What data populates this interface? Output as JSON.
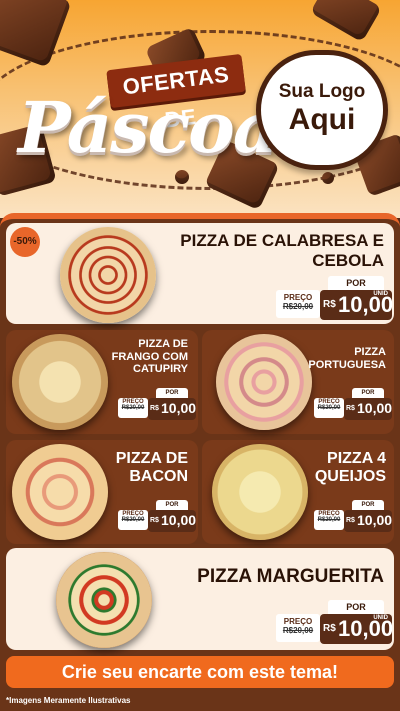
{
  "header": {
    "title_top": "OFERTAS DE",
    "title_main": "Páscoa",
    "logo_line1": "Sua Logo",
    "logo_line2": "Aqui"
  },
  "discount_badge": "-50%",
  "price_labels": {
    "preco": "PREÇO",
    "por": "POR",
    "unid": "UNID",
    "currency": "R$"
  },
  "products": [
    {
      "name_line1": "PIZZA DE CALABRESA E",
      "name_line2": "CEBOLA",
      "old_price": "R$20,00",
      "new_price": "10,00"
    },
    {
      "name_line1": "PIZZA DE",
      "name_line2": "FRANGO COM",
      "name_line3": "CATUPIRY",
      "old_price": "R$20,00",
      "new_price": "10,00"
    },
    {
      "name_line1": "PIZZA",
      "name_line2": "PORTUGUESA",
      "old_price": "R$20,00",
      "new_price": "10,00"
    },
    {
      "name_line1": "PIZZA DE",
      "name_line2": "BACON",
      "old_price": "R$20,00",
      "new_price": "10,00"
    },
    {
      "name_line1": "PIZZA 4",
      "name_line2": "QUEIJOS",
      "old_price": "R$20,00",
      "new_price": "10,00"
    },
    {
      "name_line1": "PIZZA MARGUERITA",
      "old_price": "R$20,00",
      "new_price": "10,00"
    }
  ],
  "cta": "Crie seu encarte com este tema!",
  "disclaimer": "*Imagens Meramente Ilustrativas",
  "colors": {
    "brand_brown": "#5a2c17",
    "accent_orange": "#f06a1e",
    "card_cream": "#fcefe2"
  }
}
